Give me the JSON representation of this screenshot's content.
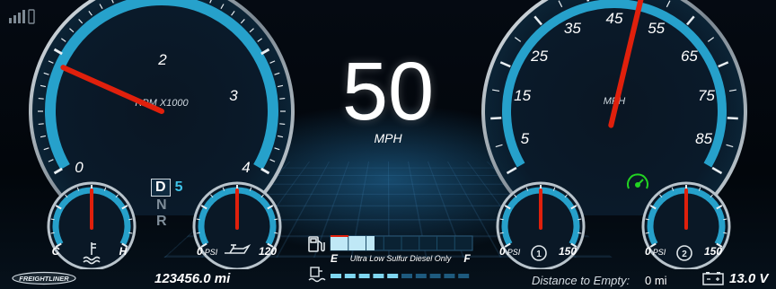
{
  "status": {
    "signal_icon": "signal-bars-icon",
    "battery_icon": "phone-battery-icon"
  },
  "tachometer": {
    "unit_label": "RPM X1000",
    "ticks": [
      "0",
      "2",
      "3",
      "4"
    ],
    "needle_value_rpm_x1000": 0.9,
    "range": [
      0,
      4
    ]
  },
  "speed": {
    "value": "50",
    "unit": "MPH"
  },
  "speedometer": {
    "unit_label": "MPH",
    "ticks": [
      "5",
      "15",
      "25",
      "35",
      "45",
      "55",
      "65",
      "75",
      "85"
    ],
    "needle_value_mph": 50,
    "range": [
      0,
      90
    ],
    "cruise_icon": "cruise-control-icon",
    "cruise_color": "#22d322"
  },
  "gear_selector": {
    "items": [
      "D",
      "N",
      "R"
    ],
    "active": "D",
    "gear_number": "5"
  },
  "coolant_gauge": {
    "min_label": "C",
    "max_label": "H",
    "icon": "coolant-temperature-icon",
    "level_fraction": 0.5
  },
  "oil_gauge": {
    "min_label": "0",
    "unit": "PSI",
    "max_label": "120",
    "icon": "oil-can-icon",
    "level_fraction": 0.5
  },
  "air1_gauge": {
    "min_label": "0",
    "unit": "PSI",
    "max_label": "150",
    "icon": "air-pressure-1-icon",
    "badge": "1",
    "level_fraction": 0.5
  },
  "air2_gauge": {
    "min_label": "0",
    "unit": "PSI",
    "max_label": "150",
    "icon": "air-pressure-2-icon",
    "badge": "2",
    "level_fraction": 0.5
  },
  "fuel": {
    "icon": "fuel-pump-icon",
    "empty_label": "E",
    "full_label": "F",
    "note": "Ultra Low Sulfur Diesel Only",
    "level_fraction": 0.31
  },
  "def": {
    "icon": "def-fluid-icon",
    "level_fraction": 0.5
  },
  "footer": {
    "logo": "FREIGHTLINER",
    "odometer": "123456.0 mi",
    "distance_label": "Distance to Empty:",
    "distance_value": "0 mi",
    "battery_icon": "battery-icon",
    "voltage": "13.0 V"
  },
  "colors": {
    "accent": "#2bb8e8",
    "needle": "#e0200c",
    "ring": "#b9c4cc"
  }
}
